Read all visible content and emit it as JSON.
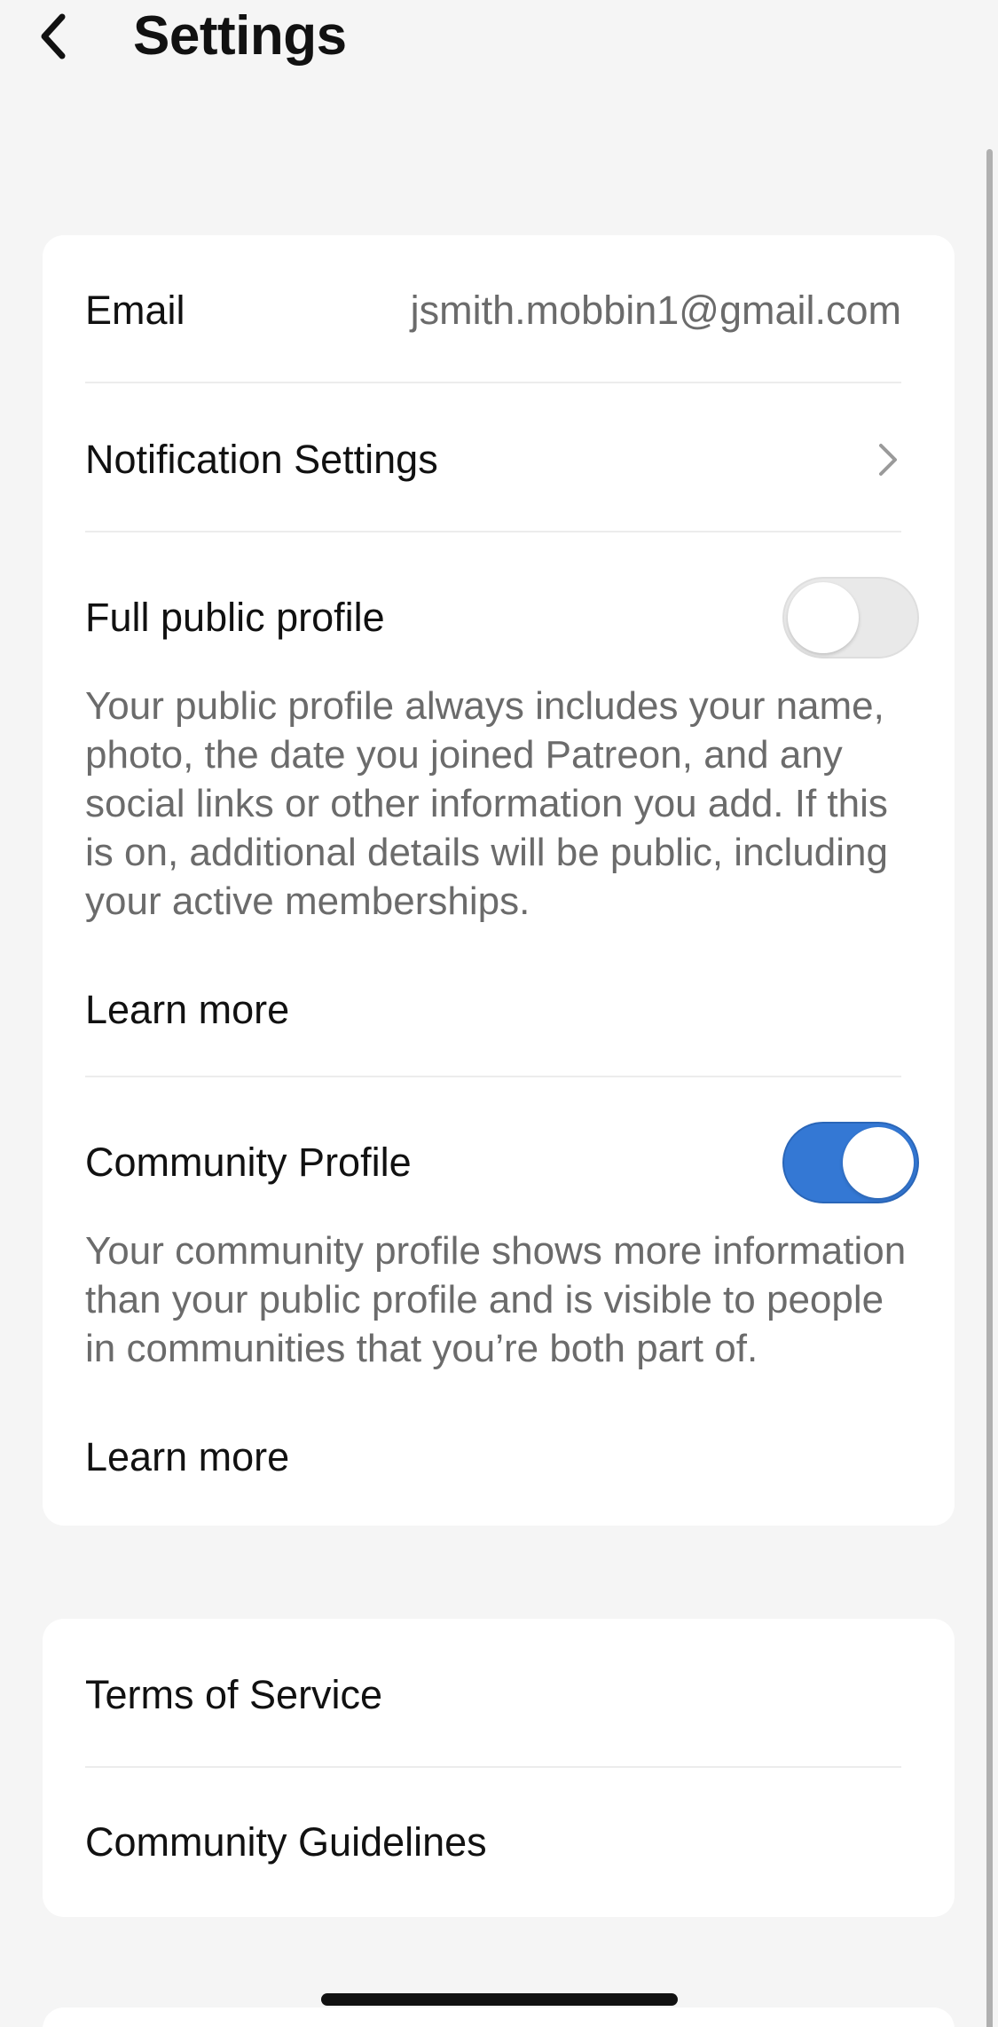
{
  "header": {
    "title": "Settings",
    "back_icon": "chevron-left-icon"
  },
  "account_card": {
    "email_label": "Email",
    "email_value": "jsmith.mobbin1@gmail.com",
    "notification_label": "Notification Settings",
    "notification_icon": "chevron-right-icon",
    "full_public_profile": {
      "label": "Full public profile",
      "enabled": false,
      "description": "Your public profile always includes your name, photo, the date you joined Patreon, and any social links or other information you add. If this is on, additional details will be public, including your active memberships.",
      "learn_more": "Learn more"
    },
    "community_profile": {
      "label": "Community Profile",
      "enabled": true,
      "description": "Your community profile shows more information than your public profile and is visible to people in communities that you’re both part of.",
      "learn_more": "Learn more"
    }
  },
  "legal_card": {
    "terms_label": "Terms of Service",
    "guidelines_label": "Community Guidelines"
  },
  "colors": {
    "background": "#f5f5f5",
    "card": "#ffffff",
    "toggle_on": "#3478d4",
    "toggle_off": "#e9e9e9",
    "secondary_text": "#6b6b6b"
  }
}
